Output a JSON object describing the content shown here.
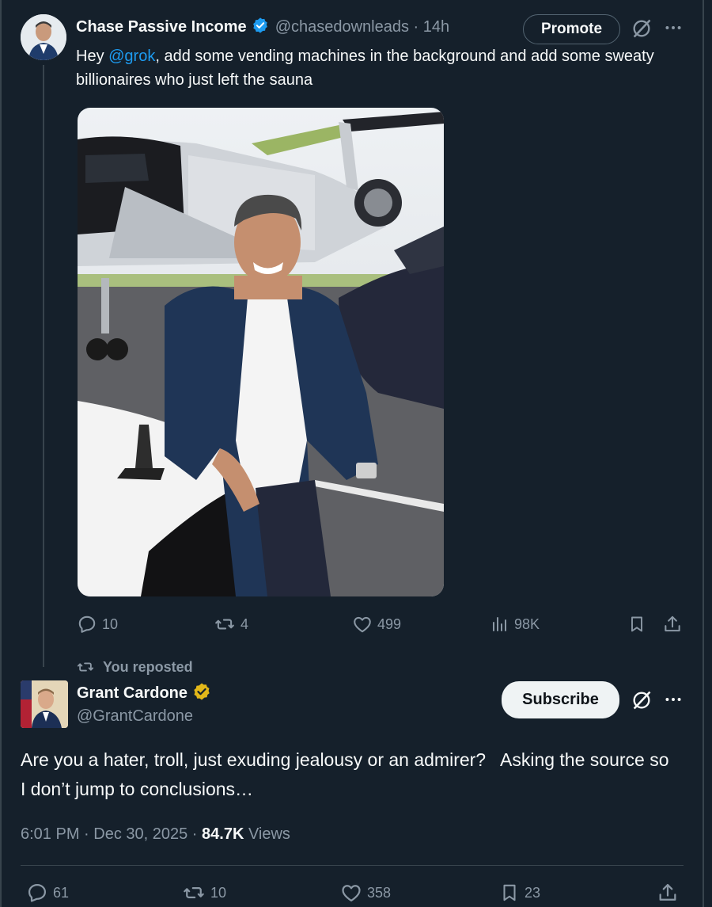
{
  "reply_tweet": {
    "author_name": "Chase Passive Income",
    "handle": "@chasedownleads",
    "time_sep": " · ",
    "time": "14h",
    "promote_label": "Promote",
    "text_prefix": "Hey ",
    "mention": "@grok",
    "text_suffix": ", add some vending machines in the background and add some sweaty billionaires who just left the sauna",
    "stats": {
      "replies": "10",
      "reposts": "4",
      "likes": "499",
      "views": "98K"
    }
  },
  "repost_note": "You reposted",
  "main_tweet": {
    "author_name": "Grant Cardone",
    "handle": "@GrantCardone",
    "subscribe_label": "Subscribe",
    "text": "Are you a hater, troll, just exuding jealousy or an admirer?   Asking the source so I don’t jump to conclusions…",
    "time": "6:01 PM · Dec 30, 2025 · ",
    "views_count": "84.7K",
    "views_label": " Views",
    "stats": {
      "replies": "61",
      "reposts": "10",
      "likes": "358",
      "bookmarks": "23"
    }
  },
  "colors": {
    "background": "#15202b",
    "text": "#f7f9f9",
    "muted": "#8b98a5",
    "link": "#1d9bf0",
    "verified_blue": "#1d9bf0",
    "verified_gold": "#e2b719",
    "border": "#38444d"
  },
  "icons": [
    "verified-badge-icon",
    "grok-icon",
    "more-icon",
    "reply-icon",
    "repost-icon",
    "like-icon",
    "views-icon",
    "bookmark-icon",
    "share-icon"
  ]
}
